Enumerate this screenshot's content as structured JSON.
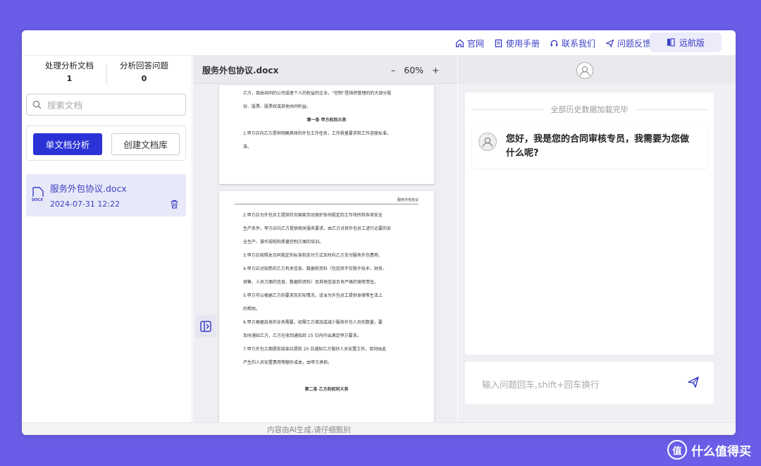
{
  "nav": {
    "links": [
      {
        "icon": "home-icon",
        "label": "官网"
      },
      {
        "icon": "book-icon",
        "label": "使用手册"
      },
      {
        "icon": "headset-icon",
        "label": "联系我们"
      },
      {
        "icon": "send-icon",
        "label": "问题反馈"
      }
    ],
    "lite_label": "远航版"
  },
  "sidebar": {
    "stats": [
      {
        "label": "处理分析文档",
        "value": "1"
      },
      {
        "label": "分析回答问题",
        "value": "0"
      }
    ],
    "search_placeholder": "搜索文档",
    "single_doc_button": "单文档分析",
    "create_lib_button": "创建文档库",
    "doc": {
      "name": "服务外包协议.docx",
      "date": "2024-07-31 12:22",
      "ext": "DOCX"
    }
  },
  "viewer": {
    "title": "服务外包协议.docx",
    "zoom_out": "–",
    "zoom": "60%",
    "zoom_in": "+",
    "page1": [
      "乙方，接由共同的公司或者个人的权益的企业。“控制”是指将管理的的大部分股",
      "份、股票、股票权或其他共同利益。",
      "第一条 甲方权利义务",
      "1.甲方应向乙方提供明确具体的外包工作任务，工作质量要求和工作进度标准。",
      "准。"
    ],
    "page2_header": "服务外包协议",
    "page2": [
      "2.甲方应为外包员工提供符合国家劳动保护条例规定的工作场所和各项安全",
      "生产条件。甲方应向乙方提供相关服务要求，由乙方对其外包员工进行必要的安",
      "全生产、操作规程和质量控制方面的培训。",
      "3.甲方应按照本合同规定的标准和支付方式及时向乙方支付服务外包费用。",
      "4.甲方应对知悉的乙方有关信息、数据和资料（包括但不仅限于技术、财务、",
      "销售、人员方面的信息、数据和资料）及其他信息负有严格的保密责任。",
      "5.甲方可以根据乙方的要求及实际情况，适当为外包员工提供食宿等生活上",
      "的帮助。",
      "6.甲方根据自身的业务需要，如需乙方增加或减少服务外包人员的数量，要",
      "及时通知乙方，乙方在收到通知后 15 日内作出满足甲方要求。",
      "7.甲方外包工期提前结束应提前 20 日通知乙方做好人员安置工作，否则由此",
      "产生的人员安置费用等额外成本，由甲方承担。",
      "",
      "第二条 乙方的权利义务"
    ]
  },
  "chat": {
    "history_loaded": "全部历史数据加载完毕",
    "greeting": "您好，我是您的合同审核专员，我需要为您做什么呢?",
    "input_placeholder": "输入问题回车,shift+回车换行"
  },
  "footer": {
    "text": "内容由AI生成,请仔细甄别"
  },
  "watermark": {
    "text": "什么值得买",
    "logo_char": "值"
  }
}
